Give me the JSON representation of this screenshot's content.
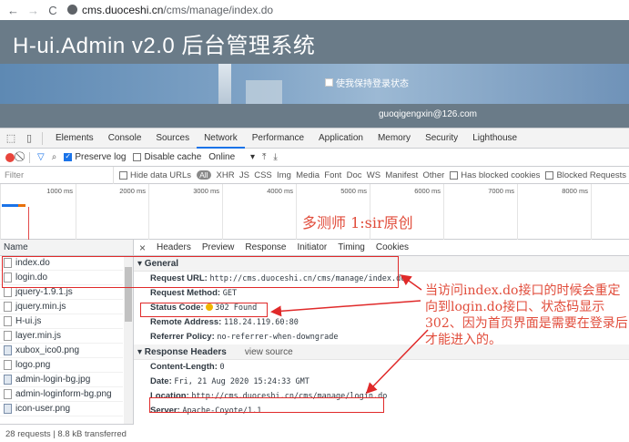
{
  "browser": {
    "back_glyph": "←",
    "forward_glyph": "→",
    "reload_glyph": "C",
    "url_host": "cms.duoceshi.cn",
    "url_path": "/cms/manage/index.do"
  },
  "page": {
    "title": "H-ui.Admin v2.0 后台管理系统",
    "remember_label": "使我保持登录状态",
    "user_email": "guoqigengxin@126.com"
  },
  "devtools": {
    "tabs": [
      "Elements",
      "Console",
      "Sources",
      "Network",
      "Performance",
      "Application",
      "Memory",
      "Security",
      "Lighthouse"
    ],
    "active_tab": "Network",
    "toolbar": {
      "preserve_log": "Preserve log",
      "disable_cache": "Disable cache",
      "throttle": "Online"
    },
    "filter": {
      "placeholder": "Filter",
      "hide_data_urls": "Hide data URLs",
      "all": "All",
      "types": "XHR  JS  CSS  Img  Media  Font  Doc  WS  Manifest  Other",
      "has_blocked": "Has blocked cookies",
      "blocked_requests": "Blocked Requests"
    },
    "timeline_ticks": [
      "1000 ms",
      "2000 ms",
      "3000 ms",
      "4000 ms",
      "5000 ms",
      "6000 ms",
      "7000 ms",
      "8000 ms"
    ],
    "watermark": "多测师 1:sir原创",
    "list": {
      "header": "Name",
      "rows": [
        {
          "name": "index.do",
          "icon": "file-icon"
        },
        {
          "name": "login.do",
          "icon": "file-icon"
        },
        {
          "name": "jquery-1.9.1.js",
          "icon": "file-icon"
        },
        {
          "name": "jquery.min.js",
          "icon": "file-icon"
        },
        {
          "name": "H-ui.js",
          "icon": "file-icon"
        },
        {
          "name": "layer.min.js",
          "icon": "file-icon"
        },
        {
          "name": "xubox_ico0.png",
          "icon": "image-icon"
        },
        {
          "name": "logo.png",
          "icon": "file-icon"
        },
        {
          "name": "admin-login-bg.jpg",
          "icon": "image-icon"
        },
        {
          "name": "admin-loginform-bg.png",
          "icon": "file-icon"
        },
        {
          "name": "icon-user.png",
          "icon": "image-icon"
        }
      ],
      "status": "28 requests  |  8.8 kB transferred"
    },
    "detail": {
      "tabs": [
        "Headers",
        "Preview",
        "Response",
        "Initiator",
        "Timing",
        "Cookies"
      ],
      "close_glyph": "×",
      "general_title": "▾ General",
      "general": [
        {
          "k": "Request URL:",
          "v": "http://cms.duoceshi.cn/cms/manage/index.do"
        },
        {
          "k": "Request Method:",
          "v": "GET"
        },
        {
          "k": "Status Code:",
          "v": "302 Found"
        },
        {
          "k": "Remote Address:",
          "v": "118.24.119.60:80"
        },
        {
          "k": "Referrer Policy:",
          "v": "no-referrer-when-downgrade"
        }
      ],
      "response_title": "▾ Response Headers",
      "view_source": "view source",
      "response": [
        {
          "k": "Content-Length:",
          "v": "0"
        },
        {
          "k": "Date:",
          "v": "Fri, 21 Aug 2020 15:24:33 GMT"
        },
        {
          "k": "Location:",
          "v": "http://cms.duoceshi.cn/cms/manage/login.do"
        },
        {
          "k": "Server:",
          "v": "Apache-Coyote/1.1"
        }
      ]
    }
  },
  "annotation": "当访问index.do接口的时候会重定向到login.do接口、状态码显示302、因为首页界面是需要在登录后才能进入的。",
  "colors": {
    "annotation_red": "#e02a2a",
    "accent_blue": "#1a73e8",
    "status_yellow": "#f0b400"
  }
}
